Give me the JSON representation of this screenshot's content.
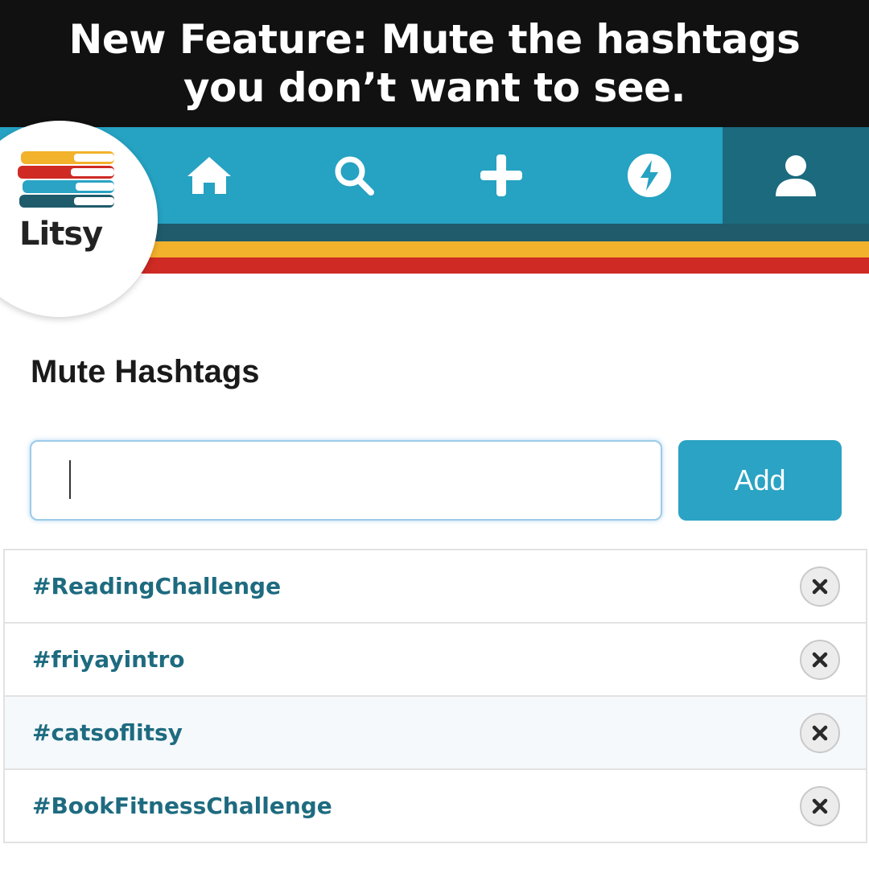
{
  "banner": {
    "line1": "New Feature: Mute the hashtags",
    "line2": "you don’t want to see."
  },
  "app": {
    "name": "Litsy",
    "colors": {
      "nav": "#26a2c2",
      "nav_active": "#1b6a7e",
      "stripe_dark": "#1f5b6b",
      "stripe_yellow": "#f2b22c",
      "stripe_red": "#cf2a24",
      "hashtag_text": "#1e6b80"
    }
  },
  "nav": {
    "items": [
      {
        "icon": "home-icon"
      },
      {
        "icon": "search-icon"
      },
      {
        "icon": "plus-icon"
      },
      {
        "icon": "lightning-bolt-icon"
      },
      {
        "icon": "profile-icon",
        "active": true
      }
    ]
  },
  "mute": {
    "title": "Mute Hashtags",
    "input_value": "",
    "add_label": "Add",
    "hashtags": [
      "#ReadingChallenge",
      "#friyayintro",
      "#catsoflitsy",
      "#BookFitnessChallenge"
    ]
  }
}
